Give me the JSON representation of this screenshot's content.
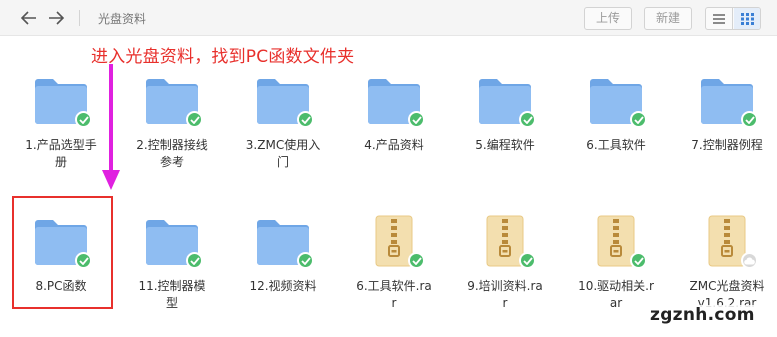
{
  "toolbar": {
    "breadcrumb": "光盘资料",
    "upload_label": "上传",
    "newfolder_label": "新建",
    "icons": [
      "back-arrow-icon",
      "forward-arrow-icon",
      "list-view-icon",
      "grid-view-icon"
    ]
  },
  "annotation": {
    "text": "进入光盘资料，找到PC函数文件夹",
    "color": "#e8302c",
    "arrow_color": "#e020e0"
  },
  "items": [
    {
      "name": "1.产品选型手册",
      "type": "folder",
      "status": "synced"
    },
    {
      "name": "2.控制器接线参考",
      "type": "folder",
      "status": "synced"
    },
    {
      "name": "3.ZMC使用入门",
      "type": "folder",
      "status": "synced"
    },
    {
      "name": "4.产品资料",
      "type": "folder",
      "status": "synced"
    },
    {
      "name": "5.编程软件",
      "type": "folder",
      "status": "synced"
    },
    {
      "name": "6.工具软件",
      "type": "folder",
      "status": "synced"
    },
    {
      "name": "7.控制器例程",
      "type": "folder",
      "status": "synced"
    },
    {
      "name": "8.PC函数",
      "type": "folder",
      "status": "synced"
    },
    {
      "name": "11.控制器模型",
      "type": "folder",
      "status": "synced"
    },
    {
      "name": "12.视频资料",
      "type": "folder",
      "status": "synced"
    },
    {
      "name": "6.工具软件.rar",
      "type": "archive",
      "status": "synced"
    },
    {
      "name": "9.培训资料.rar",
      "type": "archive",
      "status": "synced"
    },
    {
      "name": "10.驱动相关.rar",
      "type": "archive",
      "status": "synced"
    },
    {
      "name": "ZMC光盘资料v1.6.2.rar",
      "type": "archive",
      "status": "cloud"
    }
  ],
  "colors": {
    "folder": "#8fbdf2",
    "folder_tab": "#6fa6e6",
    "archive": "#f3dfaf",
    "sync_badge": "#4cbc6c"
  },
  "watermark": "zgznh.com"
}
